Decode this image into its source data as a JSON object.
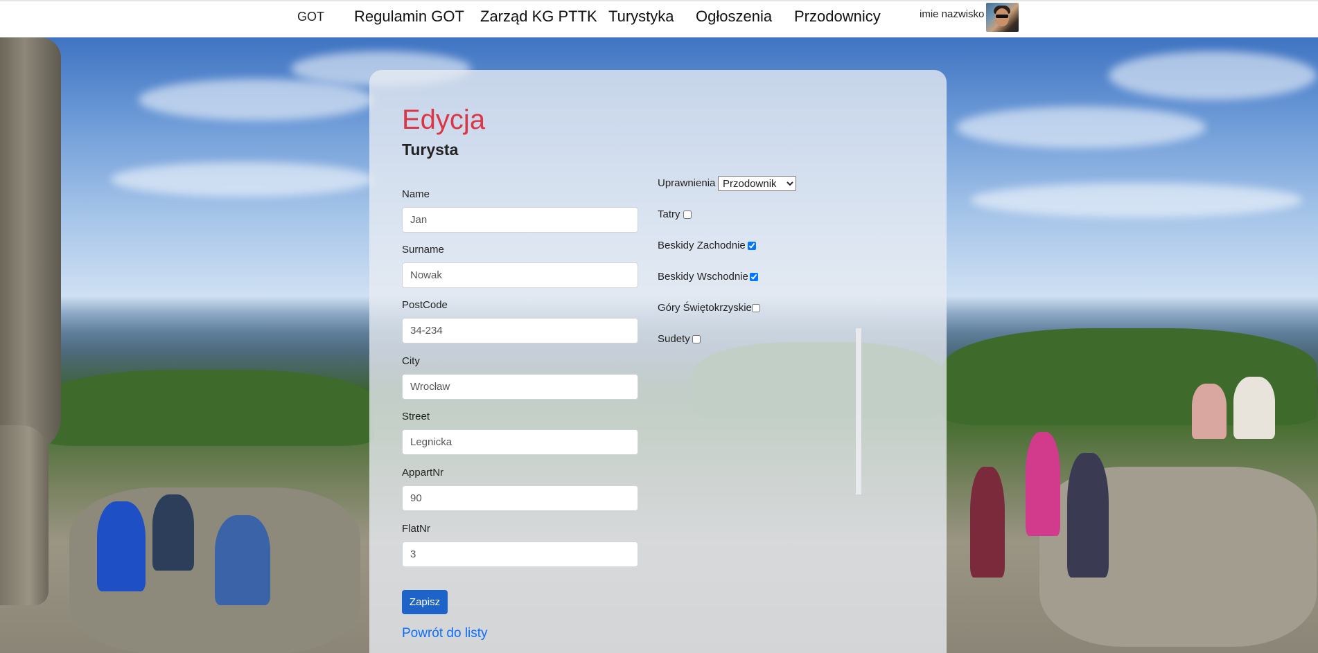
{
  "nav": {
    "brand": "GOT",
    "links": [
      "Regulamin GOT",
      "Zarząd KG PTTK",
      "Turystyka",
      "Ogłoszenia",
      "Przodownicy"
    ],
    "user_name": "imie nazwisko"
  },
  "form": {
    "title": "Edycja",
    "subtitle": "Turysta",
    "fields": [
      {
        "label": "Name",
        "value": "Jan"
      },
      {
        "label": "Surname",
        "value": "Nowak"
      },
      {
        "label": "PostCode",
        "value": "34-234"
      },
      {
        "label": "City",
        "value": "Wrocław"
      },
      {
        "label": "Street",
        "value": "Legnicka"
      },
      {
        "label": "AppartNr",
        "value": "90"
      },
      {
        "label": "FlatNr",
        "value": "3"
      }
    ],
    "permissions_label": "Uprawnienia",
    "permissions_value": "Przodownik",
    "regions": [
      {
        "label": "Tatry",
        "checked": false
      },
      {
        "label": "Beskidy Zachodnie",
        "checked": true
      },
      {
        "label": "Beskidy Wschodnie",
        "checked": true
      },
      {
        "label": "Góry Świętokrzyskie",
        "checked": false
      },
      {
        "label": "Sudety",
        "checked": false
      }
    ],
    "save_label": "Zapisz",
    "back_label": "Powrót do listy"
  },
  "colors": {
    "title_red": "#dc3545",
    "primary_blue": "#1e64c8",
    "link_blue": "#0d6efd"
  }
}
